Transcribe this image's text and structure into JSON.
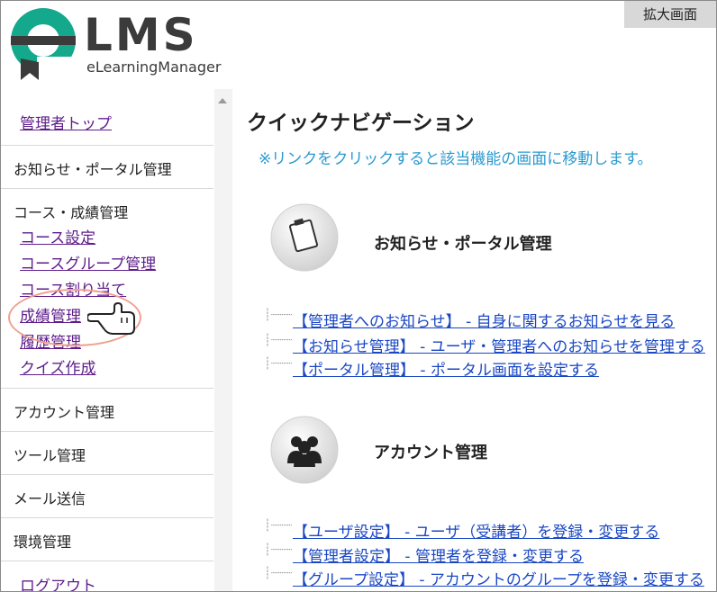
{
  "header": {
    "logo_text": "LMS",
    "logo_sub": "eLearningManager",
    "zoom_button": "拡大画面"
  },
  "sidebar": {
    "admin_top": "管理者トップ",
    "notice_portal": "お知らせ・ポータル管理",
    "course_grade": {
      "heading": "コース・成績管理",
      "items": [
        "コース設定",
        "コースグループ管理",
        "コース割り当て",
        "成績管理",
        "履歴管理",
        "クイズ作成"
      ]
    },
    "account": "アカウント管理",
    "tools": "ツール管理",
    "mail": "メール送信",
    "environment": "環境管理",
    "logout": "ログアウト"
  },
  "main": {
    "title": "クイックナビゲーション",
    "note": "※リンクをクリックすると該当機能の画面に移動します。",
    "sections": [
      {
        "title": "お知らせ・ポータル管理",
        "icon": "clipboard-icon",
        "links": [
          "【管理者へのお知らせ】 - 自身に関するお知らせを見る",
          "【お知らせ管理】 - ユーザ・管理者へのお知らせを管理する",
          "【ポータル管理】 - ポータル画面を設定する"
        ]
      },
      {
        "title": "アカウント管理",
        "icon": "users-icon",
        "links": [
          "【ユーザ設定】 - ユーザ（受講者）を登録・変更する",
          "【管理者設定】 - 管理者を登録・変更する",
          "【グループ設定】 - アカウントのグループを登録・変更する"
        ]
      }
    ]
  },
  "colors": {
    "visited_link": "#5e1d8b",
    "link": "#1a47c4",
    "note": "#2a9ad0",
    "logo_teal": "#14a88c",
    "highlight_circle": "#f0a090"
  }
}
